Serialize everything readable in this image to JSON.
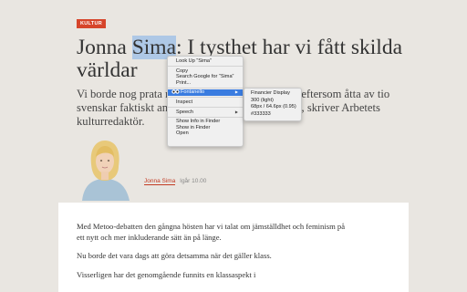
{
  "article": {
    "section_badge": "KULTUR",
    "headline_pre": "Jonna ",
    "headline_selected": "Sima",
    "headline_post": ": I tysthet har vi fått skilda världar",
    "ingress": "Vi borde nog prata m… …inst eftersom åtta av tio svenskar faktiskt ans… …e, skriver Arbetets kulturredaktör.",
    "ingress_line1_left": "Vi borde nog prata m",
    "ingress_line1_right": "inst eftersom åtta av tio",
    "ingress_line2_left": "svenskar faktiskt ans",
    "ingress_line2_right": "e, skriver Arbetets",
    "ingress_line3": "kulturredaktör.",
    "author": "Jonna Sima",
    "time": "Igår 10.00",
    "paragraphs": [
      "Med Metoo-debatten den gångna hösten har vi talat om jämställdhet och feminism på ett nytt och mer inkluderande sätt än på länge.",
      "Nu borde det vara dags att göra detsamma när det gäller klass.",
      "Visserligen har det genomgående funnits en klassaspekt i"
    ]
  },
  "context_menu": {
    "items": [
      {
        "label": "Look Up “Sima”"
      },
      {
        "label": "Copy"
      },
      {
        "label": "Search Google for “Sima”"
      },
      {
        "label": "Print..."
      },
      {
        "label": "Fontanello"
      },
      {
        "label": "Inspect"
      },
      {
        "label": "Speech"
      },
      {
        "label": "Show Info in Finder"
      },
      {
        "label": "Show in Finder"
      },
      {
        "label": "Open"
      }
    ],
    "submenu_arrow": "▶"
  },
  "fontanello_submenu": {
    "font_family": "Financier Display",
    "font_weight": "300 (light)",
    "font_size": "68px / 64.6px (0.95)",
    "font_color": "#333333"
  },
  "colors": {
    "badge": "#d6452b",
    "selection": "#aec8e6",
    "menu_highlight": "#3a7ce0",
    "author_link": "#c23b24"
  }
}
